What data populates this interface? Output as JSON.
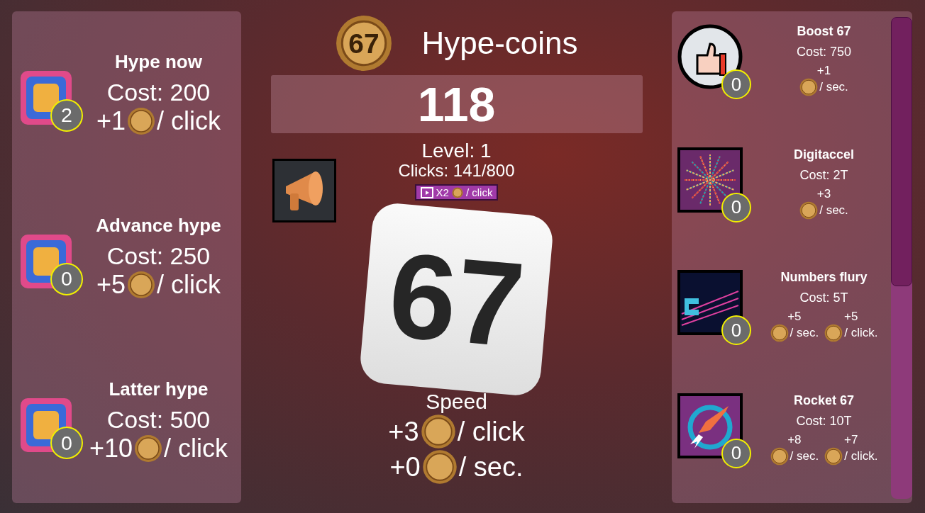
{
  "header": {
    "coin_label": "67",
    "title": "Hype-coins"
  },
  "balance": "118",
  "level": "Level: 1",
  "clicks": "Clicks: 141/800",
  "bonus": {
    "multiplier": "X2",
    "unit": "/ click"
  },
  "clicker": {
    "label": "67"
  },
  "speed": {
    "title": "Speed",
    "rows": [
      {
        "amount": "+3",
        "unit": "/ click"
      },
      {
        "amount": "+0",
        "unit": "/ sec."
      }
    ]
  },
  "left_upgrades": [
    {
      "name": "Hype now",
      "cost": "Cost: 200",
      "gain": "+1",
      "unit": "/ click",
      "count": "2"
    },
    {
      "name": "Advance hype",
      "cost": "Cost: 250",
      "gain": "+5",
      "unit": "/ click",
      "count": "0"
    },
    {
      "name": "Latter hype",
      "cost": "Cost: 500",
      "gain": "+10",
      "unit": "/ click",
      "count": "0"
    }
  ],
  "right_upgrades": [
    {
      "kind": "thumb",
      "name": "Boost 67",
      "cost": "Cost: 750",
      "count": "0",
      "effects": [
        {
          "amount": "+1",
          "unit": "/ sec."
        }
      ]
    },
    {
      "kind": "burst",
      "name": "Digitaccel",
      "cost": "Cost: 2T",
      "count": "0",
      "effects": [
        {
          "amount": "+3",
          "unit": "/ sec."
        }
      ]
    },
    {
      "kind": "numbers",
      "name": "Numbers flury",
      "cost": "Cost: 5T",
      "count": "0",
      "effects": [
        {
          "amount": "+5",
          "unit": "/ sec."
        },
        {
          "amount": "+5",
          "unit": "/ click."
        }
      ]
    },
    {
      "kind": "rocket",
      "name": "Rocket 67",
      "cost": "Cost: 10T",
      "count": "0",
      "effects": [
        {
          "amount": "+8",
          "unit": "/ sec."
        },
        {
          "amount": "+7",
          "unit": "/ click."
        }
      ]
    }
  ]
}
